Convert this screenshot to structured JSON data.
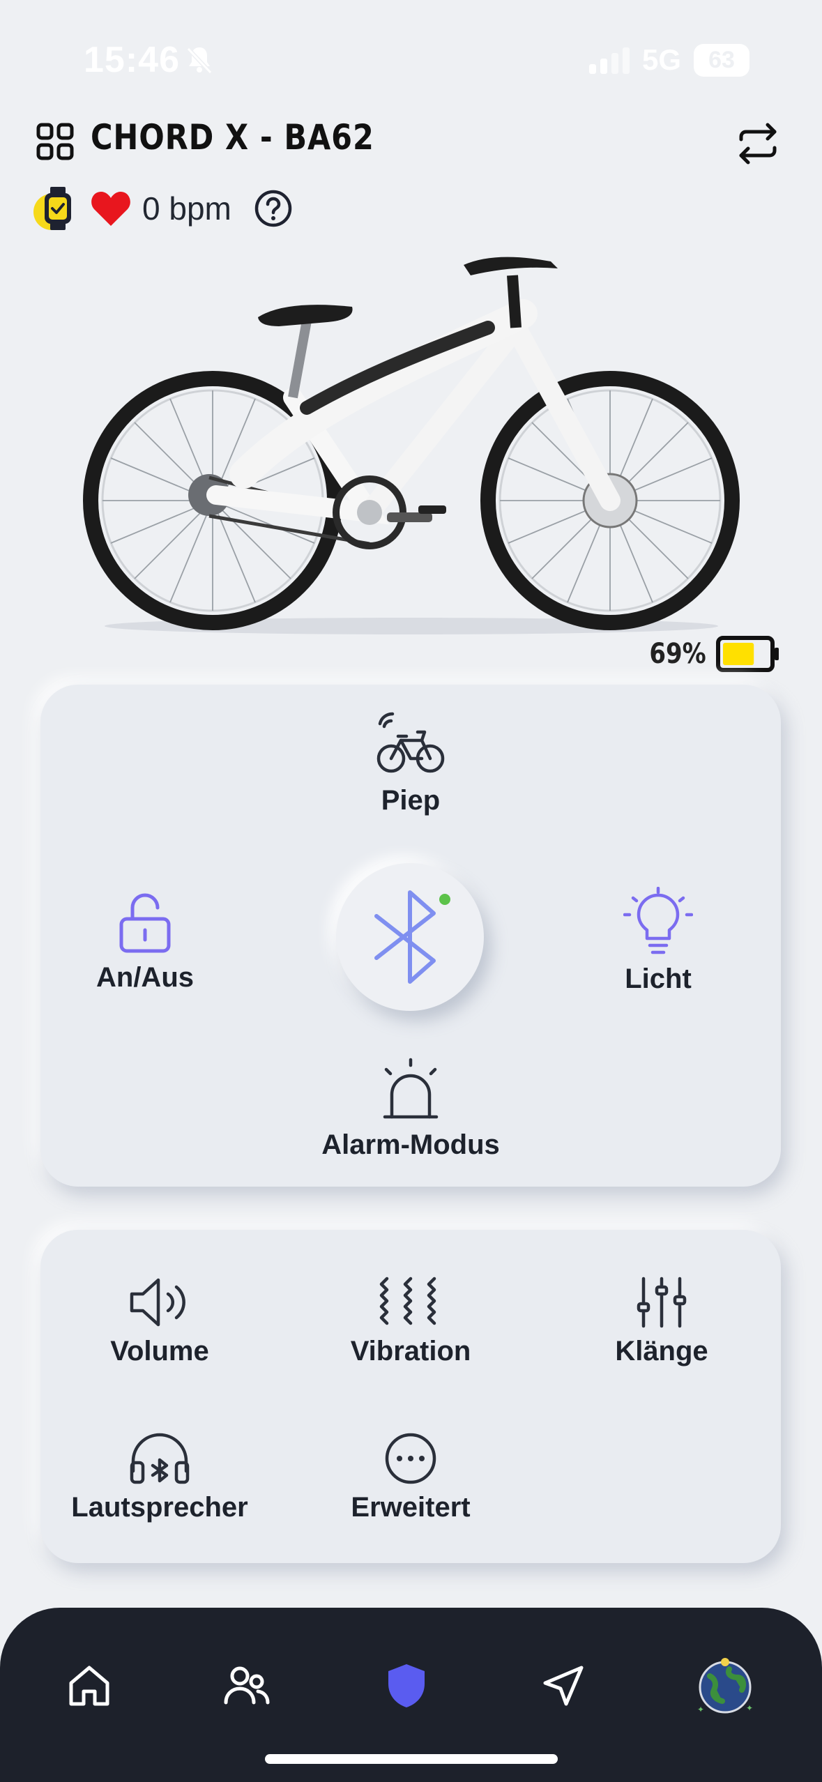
{
  "status_bar": {
    "time": "15:46",
    "network": "5G",
    "battery": "63"
  },
  "header": {
    "bike_name": "CHORD X - BA62"
  },
  "heart_rate": {
    "value": "0 bpm"
  },
  "bike": {
    "battery_percent": "69%",
    "battery_level": 0.69,
    "battery_color": "#ffe000"
  },
  "controls": {
    "piep": "Piep",
    "lock": "An/Aus",
    "light": "Licht",
    "alarm": "Alarm-Modus",
    "bluetooth_connected": true
  },
  "settings": {
    "volume": "Volume",
    "vibration": "Vibration",
    "sounds": "Klänge",
    "speaker": "Lautsprecher",
    "advanced": "Erweitert"
  },
  "nav": {
    "items": [
      "home-icon",
      "users-icon",
      "shield-icon",
      "navigation-icon",
      "globe-icon"
    ],
    "active": "shield-icon",
    "accent": "#5a5cf0"
  }
}
